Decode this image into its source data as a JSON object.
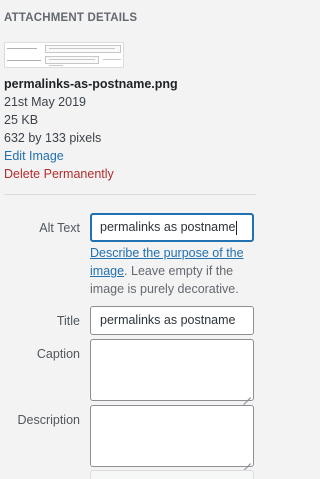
{
  "attachment_details": {
    "heading": "ATTACHMENT DETAILS",
    "filename": "permalinks-as-postname.png",
    "date": "21st May 2019",
    "file_size": "25 KB",
    "dimensions": "632 by 133 pixels",
    "edit_image_label": "Edit Image",
    "delete_label": "Delete Permanently"
  },
  "fields": {
    "alt_text": {
      "label": "Alt Text",
      "value": "permalinks as postname",
      "help_link": "Describe the purpose of the image",
      "help_rest": ". Leave empty if the image is purely decorative."
    },
    "title": {
      "label": "Title",
      "value": "permalinks as postname"
    },
    "caption": {
      "label": "Caption",
      "value": ""
    },
    "description": {
      "label": "Description",
      "value": ""
    }
  },
  "colors": {
    "link": "#2271b1",
    "delete": "#b32d2e",
    "focus_border": "#2271b1"
  }
}
